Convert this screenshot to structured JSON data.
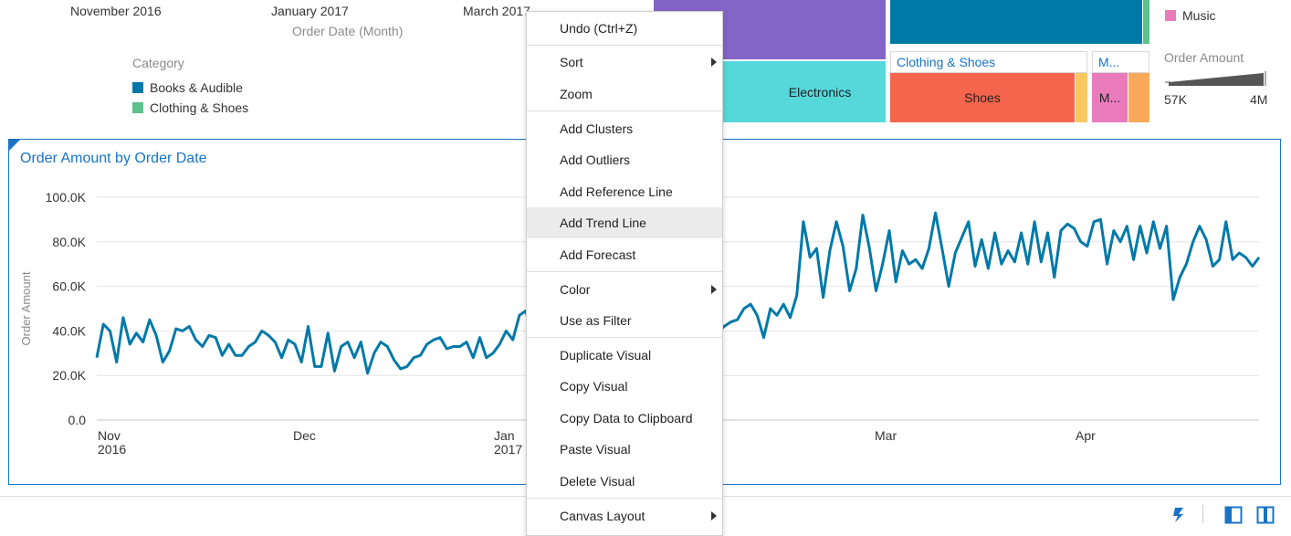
{
  "top_chart": {
    "ticks": [
      "November 2016",
      "January 2017",
      "March 2017"
    ],
    "axis_title": "Order Date (Month)",
    "legend_title": "Category",
    "legend": [
      {
        "label": "Books & Audible",
        "color": "#0079a8"
      },
      {
        "label": "Clothing & Shoes",
        "color": "#5dc18d"
      }
    ]
  },
  "treemap": {
    "electronics_label": "Electronics",
    "clothing_header": "Clothing & Shoes",
    "shoes_label": "Shoes",
    "music_header": "M...",
    "music_block_label": "M...",
    "colors": {
      "purple": "#8365c7",
      "electronics": "#56d8db",
      "books": "#0079a8",
      "clothing_strip": "#5dc18d",
      "shoes": "#f4654d",
      "yellow": "#f9c862",
      "music": "#e97bbd",
      "orange": "#f9a959"
    }
  },
  "right_legend": {
    "music_label": "Music",
    "music_color": "#e97bbd",
    "size_title": "Order Amount",
    "min_label": "57K",
    "max_label": "4M"
  },
  "line_chart": {
    "title": "Order Amount by Order Date",
    "ylabel": "Order Amount",
    "y_ticks": [
      "100.0K",
      "80.0K",
      "60.0K",
      "40.0K",
      "20.0K",
      "0.0"
    ],
    "x_ticks": [
      {
        "label": "Nov",
        "sub": "2016"
      },
      {
        "label": "Dec",
        "sub": ""
      },
      {
        "label": "Jan",
        "sub": "2017"
      },
      {
        "label": "Mar",
        "sub": ""
      },
      {
        "label": "Apr",
        "sub": ""
      }
    ]
  },
  "chart_data": {
    "type": "line",
    "title": "Order Amount by Order Date",
    "xlabel": "",
    "ylabel": "Order Amount",
    "ylim": [
      0,
      100000
    ],
    "x_range": [
      "2016-11-01",
      "2017-04-30"
    ],
    "series": [
      {
        "color": "#0079a8",
        "values": [
          28000,
          43000,
          40000,
          26000,
          46000,
          34000,
          39000,
          35000,
          45000,
          38000,
          26000,
          31000,
          41000,
          40000,
          42000,
          36000,
          33000,
          38000,
          37000,
          29000,
          34000,
          29000,
          29000,
          33000,
          35000,
          40000,
          38000,
          35000,
          28000,
          36000,
          34000,
          26000,
          42000,
          24000,
          24000,
          39000,
          22000,
          33000,
          35000,
          28000,
          35000,
          21000,
          30000,
          35000,
          33000,
          27000,
          23000,
          24000,
          28000,
          29000,
          34000,
          36000,
          37000,
          32000,
          33000,
          33000,
          35000,
          28000,
          37000,
          28000,
          30000,
          34000,
          40000,
          36000,
          47000,
          49000,
          35000,
          40000,
          44000,
          37000,
          32000,
          30000,
          33000,
          39000,
          41000,
          43000,
          38000,
          42000,
          47000,
          41000,
          44000,
          45000,
          40000,
          42000,
          43000,
          44000,
          40000,
          43000,
          42000,
          43000,
          49000,
          45000,
          47000,
          48000,
          39000,
          42000,
          44000,
          45000,
          50000,
          52000,
          47000,
          37000,
          50000,
          47000,
          52000,
          46000,
          56000,
          89000,
          73000,
          77000,
          55000,
          76000,
          89000,
          78000,
          58000,
          68000,
          92000,
          77000,
          58000,
          70000,
          85000,
          62000,
          76000,
          70000,
          72000,
          68000,
          77000,
          93000,
          77000,
          60000,
          75000,
          82000,
          89000,
          69000,
          81000,
          68000,
          84000,
          70000,
          76000,
          71000,
          84000,
          70000,
          89000,
          71000,
          84000,
          64000,
          85000,
          88000,
          86000,
          80000,
          78000,
          89000,
          90000,
          70000,
          85000,
          80000,
          87000,
          72000,
          87000,
          75000,
          89000,
          77000,
          87000,
          54000,
          64000,
          70000,
          80000,
          87000,
          81000,
          69000,
          72000,
          89000,
          72000,
          75000,
          73000,
          69000,
          73000
        ]
      }
    ],
    "x_ticks": [
      "Nov 2016",
      "Dec",
      "Jan 2017",
      "Mar",
      "Apr"
    ],
    "y_ticks": [
      "100.0K",
      "80.0K",
      "60.0K",
      "40.0K",
      "20.0K",
      "0.0"
    ],
    "grid": true
  },
  "context_menu": {
    "items": [
      {
        "label": "Undo (Ctrl+Z)",
        "submenu": false
      },
      {
        "label": "Sort",
        "submenu": true
      },
      {
        "label": "Zoom",
        "submenu": false
      },
      {
        "label": "Add Clusters",
        "submenu": false
      },
      {
        "label": "Add Outliers",
        "submenu": false
      },
      {
        "label": "Add Reference Line",
        "submenu": false
      },
      {
        "label": "Add Trend Line",
        "submenu": false
      },
      {
        "label": "Add Forecast",
        "submenu": false
      },
      {
        "label": "Color",
        "submenu": true
      },
      {
        "label": "Use as Filter",
        "submenu": false
      },
      {
        "label": "Duplicate Visual",
        "submenu": false
      },
      {
        "label": "Copy Visual",
        "submenu": false
      },
      {
        "label": "Copy Data to Clipboard",
        "submenu": false
      },
      {
        "label": "Paste Visual",
        "submenu": false
      },
      {
        "label": "Delete Visual",
        "submenu": false
      },
      {
        "label": "Canvas Layout",
        "submenu": true
      }
    ],
    "highlighted": "Add Trend Line"
  },
  "bottom_bar": {
    "icons": [
      "lightning-icon",
      "left-panel-icon",
      "right-panel-icon"
    ],
    "accent": "#1a73c4"
  }
}
